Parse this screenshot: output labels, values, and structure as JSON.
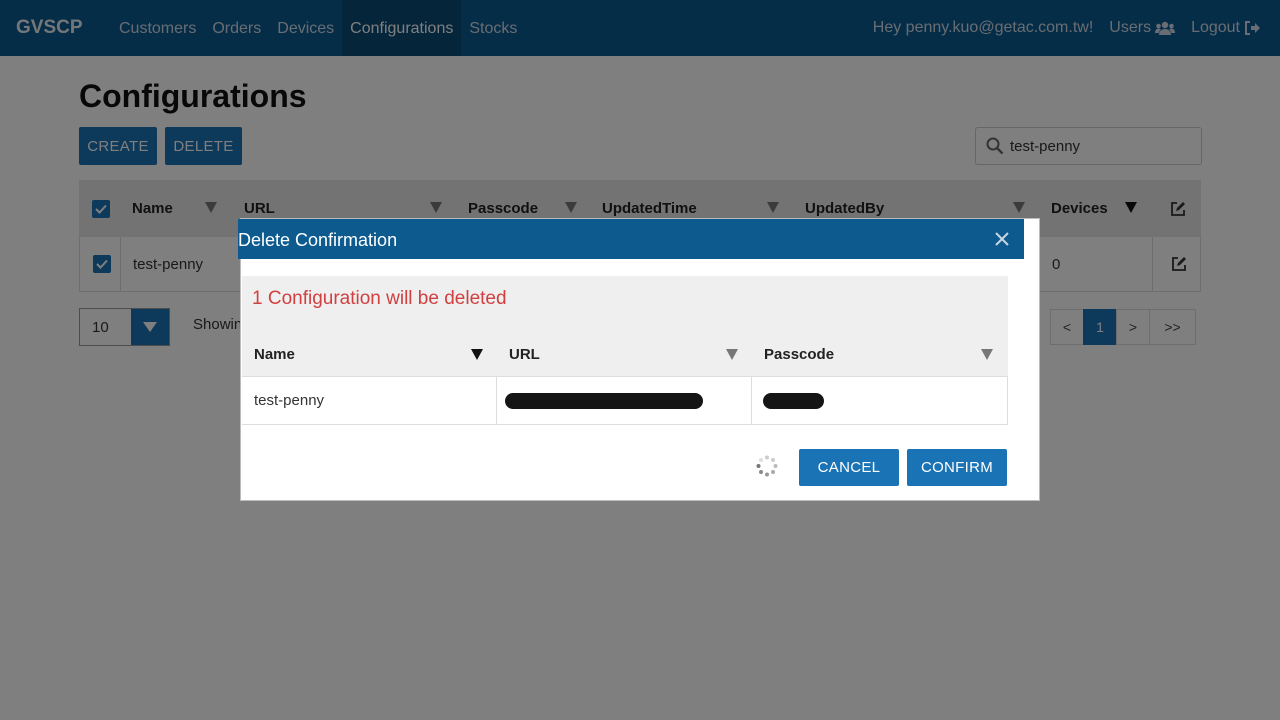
{
  "nav": {
    "brand": "GVSCP",
    "links": [
      "Customers",
      "Orders",
      "Devices",
      "Configurations",
      "Stocks"
    ],
    "active": "Configurations",
    "greeting": "Hey penny.kuo@getac.com.tw!",
    "users_label": "Users",
    "logout_label": "Logout"
  },
  "page": {
    "title": "Configurations",
    "create_label": "CREATE",
    "delete_label": "DELETE",
    "search_value": "test-penny"
  },
  "table": {
    "headers": [
      "Name",
      "URL",
      "Passcode",
      "UpdatedTime",
      "UpdatedBy",
      "Devices"
    ],
    "rows": [
      {
        "name": "test-penny",
        "devices": "0"
      }
    ]
  },
  "pager": {
    "page_size": "10",
    "showing": "Showin",
    "prev": "<",
    "current": "1",
    "next": ">",
    "last": ">>"
  },
  "modal": {
    "title": "Delete Confirmation",
    "message": "1 Configuration will be deleted",
    "headers": [
      "Name",
      "URL",
      "Passcode"
    ],
    "rows": [
      {
        "name": "test-penny"
      }
    ],
    "cancel_label": "CANCEL",
    "confirm_label": "CONFIRM"
  },
  "colors": {
    "navbar": "#0d5a8f",
    "primary": "#1a73b5",
    "warning_text": "#d04040"
  },
  "icons": [
    "users-icon",
    "logout-icon",
    "search-icon",
    "sort-icon",
    "edit-icon",
    "checkbox-icon",
    "close-icon",
    "spinner-icon"
  ]
}
